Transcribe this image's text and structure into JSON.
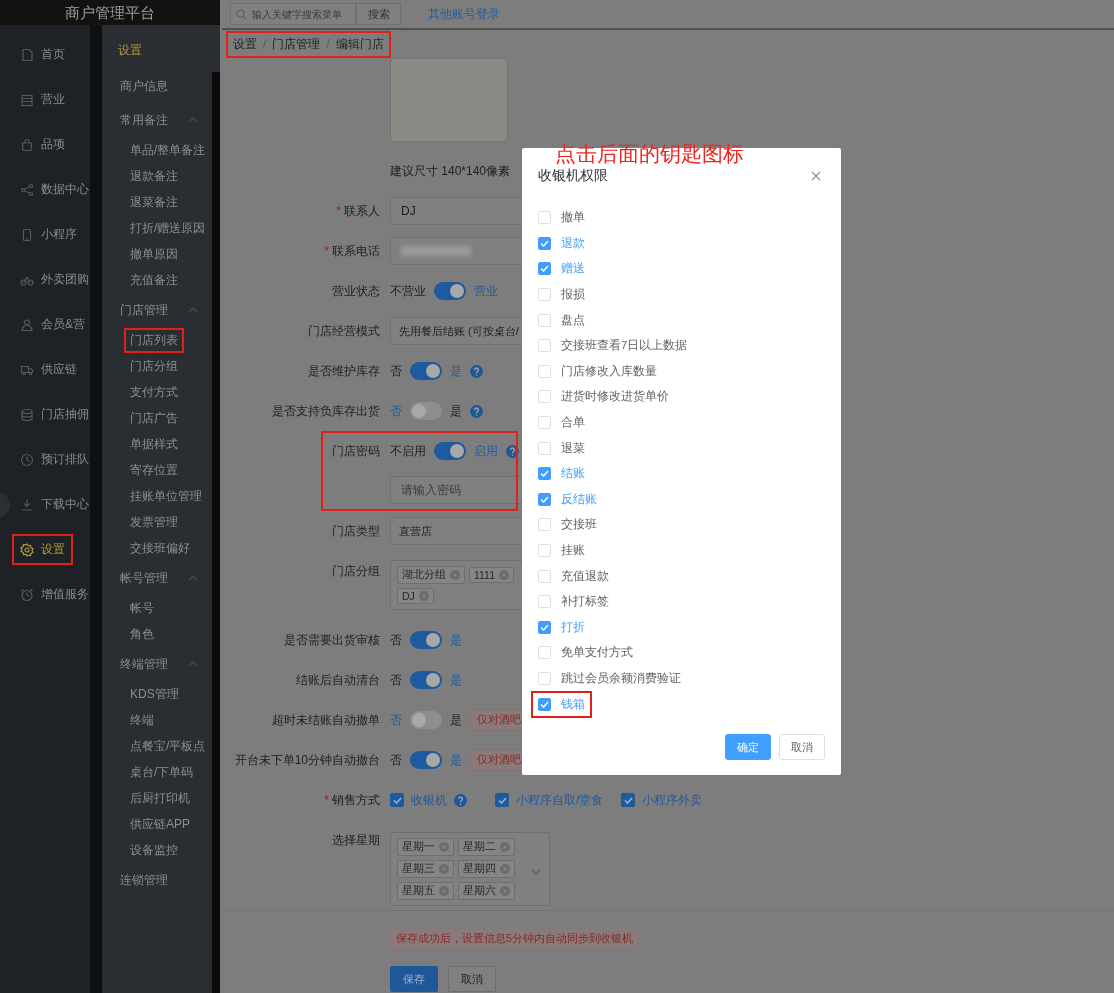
{
  "app_title": "商户管理平台",
  "nav": {
    "items": [
      {
        "label": "首页",
        "selected": false,
        "highlighted": false
      },
      {
        "label": "营业",
        "selected": false,
        "highlighted": false
      },
      {
        "label": "品项",
        "selected": false,
        "highlighted": false
      },
      {
        "label": "数据中心",
        "selected": false,
        "highlighted": false
      },
      {
        "label": "小程序",
        "selected": false,
        "highlighted": false
      },
      {
        "label": "外卖团购",
        "selected": false,
        "highlighted": false
      },
      {
        "label": "会员&营",
        "selected": false,
        "highlighted": false
      },
      {
        "label": "供应链",
        "selected": false,
        "highlighted": false
      },
      {
        "label": "门店抽佣",
        "selected": false,
        "highlighted": false
      },
      {
        "label": "预订排队",
        "selected": false,
        "highlighted": false
      },
      {
        "label": "下载中心",
        "selected": false,
        "highlighted": false
      },
      {
        "label": "设置",
        "selected": true,
        "highlighted": true
      },
      {
        "label": "增值服务",
        "selected": false,
        "highlighted": false
      }
    ]
  },
  "submenu": {
    "title": "设置",
    "items": [
      {
        "label": "商户信息",
        "highlighted": false
      },
      {
        "label": "常用备注",
        "expanded": true,
        "highlighted": false,
        "children": [
          {
            "label": "单品/整单备注",
            "highlighted": false
          },
          {
            "label": "退款备注",
            "highlighted": false
          },
          {
            "label": "退菜备注",
            "highlighted": false
          },
          {
            "label": "打折/赠送原因",
            "highlighted": false
          },
          {
            "label": "撤单原因",
            "highlighted": false
          },
          {
            "label": "充值备注",
            "highlighted": false
          }
        ]
      },
      {
        "label": "门店管理",
        "expanded": true,
        "highlighted": false,
        "children": [
          {
            "label": "门店列表",
            "highlighted": true
          },
          {
            "label": "门店分组",
            "highlighted": false
          },
          {
            "label": "支付方式",
            "highlighted": false
          },
          {
            "label": "门店广告",
            "highlighted": false
          },
          {
            "label": "单据样式",
            "highlighted": false
          },
          {
            "label": "寄存位置",
            "highlighted": false
          },
          {
            "label": "挂账单位管理",
            "highlighted": false
          },
          {
            "label": "发票管理",
            "highlighted": false
          },
          {
            "label": "交接班偏好",
            "highlighted": false
          }
        ]
      },
      {
        "label": "帐号管理",
        "expanded": true,
        "highlighted": false,
        "children": [
          {
            "label": "帐号",
            "highlighted": false
          },
          {
            "label": "角色",
            "highlighted": false
          }
        ]
      },
      {
        "label": "终端管理",
        "expanded": true,
        "highlighted": false,
        "children": [
          {
            "label": "KDS管理",
            "highlighted": false
          },
          {
            "label": "终端",
            "highlighted": false
          },
          {
            "label": "点餐宝/平板点",
            "highlighted": false
          },
          {
            "label": "桌台/下单码",
            "highlighted": false
          },
          {
            "label": "后厨打印机",
            "highlighted": false
          },
          {
            "label": "供应链APP",
            "highlighted": false
          },
          {
            "label": "设备监控",
            "highlighted": false
          }
        ]
      },
      {
        "label": "连锁管理",
        "highlighted": false
      }
    ]
  },
  "topbar": {
    "search": {
      "placeholder": "输入关键字搜索菜单"
    },
    "search_button": "搜索",
    "link": "其他账号登录"
  },
  "breadcrumb": {
    "items": [
      "设置",
      "门店管理",
      "编辑门店"
    ],
    "separators": [
      "/",
      "/"
    ],
    "highlighted": true
  },
  "form": {
    "image_hint": "建议尺寸 140*140像素",
    "rows": [
      {
        "kind": "input",
        "label": "联系人",
        "required_mark": "*",
        "value": "DJ",
        "highlighted": false
      },
      {
        "kind": "redacted",
        "label": "联系电话",
        "required_mark": "*",
        "highlighted": false
      },
      {
        "kind": "switch",
        "label": "营业状态",
        "off_label": "不营业",
        "on_label": "营业",
        "on": true,
        "highlighted": false
      },
      {
        "kind": "select",
        "label": "门店经营模式",
        "value": "先用餐后结账 (可按桌台/",
        "highlighted": false
      },
      {
        "kind": "switch",
        "label": "是否维护库存",
        "off_label": "否",
        "on_label": "是",
        "on": true,
        "help": true,
        "highlighted": false
      },
      {
        "kind": "switch",
        "label": "是否支持负库存出货",
        "off_label": "否",
        "on_label": "是",
        "on": false,
        "help": true,
        "highlighted": false
      },
      {
        "kind": "switch",
        "label": "门店密码",
        "off_label": "不启用",
        "on_label": "启用",
        "on": true,
        "help": true,
        "password_placeholder": "请输入密码",
        "highlighted": true
      },
      {
        "kind": "select",
        "label": "门店类型",
        "value": "直营店",
        "highlighted": false
      },
      {
        "kind": "tags",
        "label": "门店分组",
        "tags": [
          "湖北分组",
          "1111",
          "DJ"
        ],
        "highlighted": false
      },
      {
        "kind": "switch",
        "label": "是否需要出货审核",
        "off_label": "否",
        "on_label": "是",
        "on": true,
        "highlighted": false
      },
      {
        "kind": "switch",
        "label": "结账后自动清台",
        "off_label": "否",
        "on_label": "是",
        "on": true,
        "highlighted": false
      },
      {
        "kind": "switch",
        "label": "超时未结账自动撤单",
        "off_label": "否",
        "on_label": "是",
        "on": false,
        "note": "仅对酒吧",
        "highlighted": false
      },
      {
        "kind": "switch",
        "label": "开台未下单10分钟自动撤台",
        "off_label": "否",
        "on_label": "是",
        "on": true,
        "note": "仅对酒吧",
        "highlighted": false
      },
      {
        "kind": "checkboxes",
        "label": "销售方式",
        "required_mark": "*",
        "highlighted": false,
        "options": [
          {
            "label": "收银机",
            "checked": true,
            "help": true
          },
          {
            "label": "小程序自取/堂食",
            "checked": true
          },
          {
            "label": "小程序外卖",
            "checked": true
          }
        ]
      },
      {
        "kind": "tags",
        "label": "选择星期",
        "dropdown": true,
        "tags": [
          "星期一",
          "星期二",
          "星期三",
          "星期四",
          "星期五",
          "星期六"
        ],
        "highlighted": false
      }
    ],
    "notice": "保存成功后，设置信息5分钟内自动同步到收银机",
    "buttons": [
      {
        "label": "保存",
        "kind": "primary"
      },
      {
        "label": "取消",
        "kind": "default"
      }
    ]
  },
  "dialog": {
    "title": "收银机权限",
    "items": [
      {
        "label": "撤单",
        "checked": false,
        "highlighted": false
      },
      {
        "label": "退款",
        "checked": true,
        "highlighted": false
      },
      {
        "label": "赠送",
        "checked": true,
        "highlighted": false
      },
      {
        "label": "报损",
        "checked": false,
        "highlighted": false
      },
      {
        "label": "盘点",
        "checked": false,
        "highlighted": false
      },
      {
        "label": "交接班查看7日以上数据",
        "checked": false,
        "highlighted": false
      },
      {
        "label": "门店修改入库数量",
        "checked": false,
        "highlighted": false
      },
      {
        "label": "进货时修改进货单价",
        "checked": false,
        "highlighted": false
      },
      {
        "label": "合单",
        "checked": false,
        "highlighted": false
      },
      {
        "label": "退菜",
        "checked": false,
        "highlighted": false
      },
      {
        "label": "结账",
        "checked": true,
        "highlighted": false
      },
      {
        "label": "反结账",
        "checked": true,
        "highlighted": false
      },
      {
        "label": "交接班",
        "checked": false,
        "highlighted": false
      },
      {
        "label": "挂账",
        "checked": false,
        "highlighted": false
      },
      {
        "label": "充值退款",
        "checked": false,
        "highlighted": false
      },
      {
        "label": "补打标签",
        "checked": false,
        "highlighted": false
      },
      {
        "label": "打折",
        "checked": true,
        "highlighted": false
      },
      {
        "label": "免单支付方式",
        "checked": false,
        "highlighted": false
      },
      {
        "label": "跳过会员余额消费验证",
        "checked": false,
        "highlighted": false
      },
      {
        "label": "钱箱",
        "checked": true,
        "highlighted": true
      }
    ],
    "buttons": [
      {
        "label": "确定",
        "kind": "primary"
      },
      {
        "label": "取消",
        "kind": "default"
      }
    ]
  },
  "annotation": {
    "text": "点击后面的钥匙图标"
  }
}
